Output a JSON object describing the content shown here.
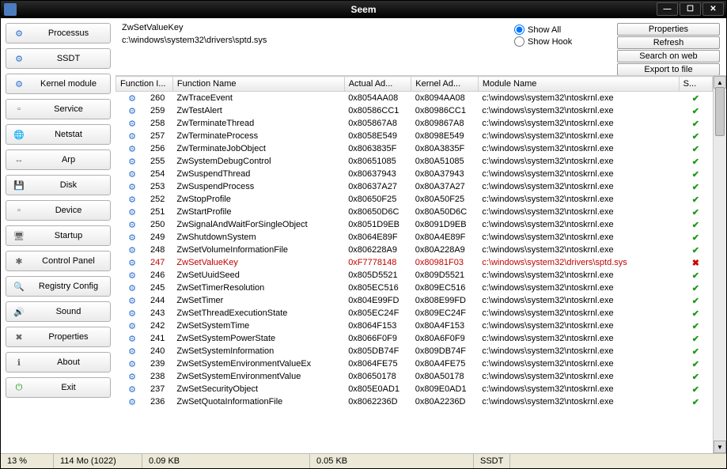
{
  "title": "Seem",
  "info": {
    "function_name": "ZwSetValueKey",
    "path": "c:\\windows\\system32\\drivers\\sptd.sys"
  },
  "radios": {
    "show_all": "Show All",
    "show_hook": "Show Hook",
    "selected": "show_all"
  },
  "buttons": {
    "properties": "Properties",
    "refresh": "Refresh",
    "search_web": "Search on web",
    "export": "Export to file"
  },
  "sidebar": [
    {
      "icon": "gear",
      "label": "Processus"
    },
    {
      "icon": "gear",
      "label": "SSDT"
    },
    {
      "icon": "gear",
      "label": "Kernel module"
    },
    {
      "icon": "page",
      "label": "Service"
    },
    {
      "icon": "globe",
      "label": "Netstat"
    },
    {
      "icon": "net",
      "label": "Arp"
    },
    {
      "icon": "disk",
      "label": "Disk"
    },
    {
      "icon": "page",
      "label": "Device"
    },
    {
      "icon": "monitor",
      "label": "Startup"
    },
    {
      "icon": "star",
      "label": "Control Panel"
    },
    {
      "icon": "search",
      "label": "Registry Config"
    },
    {
      "icon": "sound",
      "label": "Sound"
    },
    {
      "icon": "tools",
      "label": "Properties"
    },
    {
      "icon": "info",
      "label": "About"
    },
    {
      "icon": "power",
      "label": "Exit"
    }
  ],
  "columns": {
    "idx": "Function I...",
    "name": "Function Name",
    "actual": "Actual Ad...",
    "kernel": "Kernel Ad...",
    "module": "Module Name",
    "status": "S..."
  },
  "rows": [
    {
      "idx": "260",
      "name": "ZwTraceEvent",
      "actual": "0x8054AA08",
      "kernel": "0x8094AA08",
      "module": "c:\\windows\\system32\\ntoskrnl.exe",
      "ok": true
    },
    {
      "idx": "259",
      "name": "ZwTestAlert",
      "actual": "0x80586CC1",
      "kernel": "0x80986CC1",
      "module": "c:\\windows\\system32\\ntoskrnl.exe",
      "ok": true
    },
    {
      "idx": "258",
      "name": "ZwTerminateThread",
      "actual": "0x805867A8",
      "kernel": "0x809867A8",
      "module": "c:\\windows\\system32\\ntoskrnl.exe",
      "ok": true
    },
    {
      "idx": "257",
      "name": "ZwTerminateProcess",
      "actual": "0x8058E549",
      "kernel": "0x8098E549",
      "module": "c:\\windows\\system32\\ntoskrnl.exe",
      "ok": true
    },
    {
      "idx": "256",
      "name": "ZwTerminateJobObject",
      "actual": "0x8063835F",
      "kernel": "0x80A3835F",
      "module": "c:\\windows\\system32\\ntoskrnl.exe",
      "ok": true
    },
    {
      "idx": "255",
      "name": "ZwSystemDebugControl",
      "actual": "0x80651085",
      "kernel": "0x80A51085",
      "module": "c:\\windows\\system32\\ntoskrnl.exe",
      "ok": true
    },
    {
      "idx": "254",
      "name": "ZwSuspendThread",
      "actual": "0x80637943",
      "kernel": "0x80A37943",
      "module": "c:\\windows\\system32\\ntoskrnl.exe",
      "ok": true
    },
    {
      "idx": "253",
      "name": "ZwSuspendProcess",
      "actual": "0x80637A27",
      "kernel": "0x80A37A27",
      "module": "c:\\windows\\system32\\ntoskrnl.exe",
      "ok": true
    },
    {
      "idx": "252",
      "name": "ZwStopProfile",
      "actual": "0x80650F25",
      "kernel": "0x80A50F25",
      "module": "c:\\windows\\system32\\ntoskrnl.exe",
      "ok": true
    },
    {
      "idx": "251",
      "name": "ZwStartProfile",
      "actual": "0x80650D6C",
      "kernel": "0x80A50D6C",
      "module": "c:\\windows\\system32\\ntoskrnl.exe",
      "ok": true
    },
    {
      "idx": "250",
      "name": "ZwSignalAndWaitForSingleObject",
      "actual": "0x8051D9EB",
      "kernel": "0x8091D9EB",
      "module": "c:\\windows\\system32\\ntoskrnl.exe",
      "ok": true
    },
    {
      "idx": "249",
      "name": "ZwShutdownSystem",
      "actual": "0x8064E89F",
      "kernel": "0x80A4E89F",
      "module": "c:\\windows\\system32\\ntoskrnl.exe",
      "ok": true
    },
    {
      "idx": "248",
      "name": "ZwSetVolumeInformationFile",
      "actual": "0x806228A9",
      "kernel": "0x80A228A9",
      "module": "c:\\windows\\system32\\ntoskrnl.exe",
      "ok": true
    },
    {
      "idx": "247",
      "name": "ZwSetValueKey",
      "actual": "0xF7778148",
      "kernel": "0x80981F03",
      "module": "c:\\windows\\system32\\drivers\\sptd.sys",
      "ok": false,
      "hooked": true
    },
    {
      "idx": "246",
      "name": "ZwSetUuidSeed",
      "actual": "0x805D5521",
      "kernel": "0x809D5521",
      "module": "c:\\windows\\system32\\ntoskrnl.exe",
      "ok": true
    },
    {
      "idx": "245",
      "name": "ZwSetTimerResolution",
      "actual": "0x805EC516",
      "kernel": "0x809EC516",
      "module": "c:\\windows\\system32\\ntoskrnl.exe",
      "ok": true
    },
    {
      "idx": "244",
      "name": "ZwSetTimer",
      "actual": "0x804E99FD",
      "kernel": "0x808E99FD",
      "module": "c:\\windows\\system32\\ntoskrnl.exe",
      "ok": true
    },
    {
      "idx": "243",
      "name": "ZwSetThreadExecutionState",
      "actual": "0x805EC24F",
      "kernel": "0x809EC24F",
      "module": "c:\\windows\\system32\\ntoskrnl.exe",
      "ok": true
    },
    {
      "idx": "242",
      "name": "ZwSetSystemTime",
      "actual": "0x8064F153",
      "kernel": "0x80A4F153",
      "module": "c:\\windows\\system32\\ntoskrnl.exe",
      "ok": true
    },
    {
      "idx": "241",
      "name": "ZwSetSystemPowerState",
      "actual": "0x8066F0F9",
      "kernel": "0x80A6F0F9",
      "module": "c:\\windows\\system32\\ntoskrnl.exe",
      "ok": true
    },
    {
      "idx": "240",
      "name": "ZwSetSystemInformation",
      "actual": "0x805DB74F",
      "kernel": "0x809DB74F",
      "module": "c:\\windows\\system32\\ntoskrnl.exe",
      "ok": true
    },
    {
      "idx": "239",
      "name": "ZwSetSystemEnvironmentValueEx",
      "actual": "0x8064FE75",
      "kernel": "0x80A4FE75",
      "module": "c:\\windows\\system32\\ntoskrnl.exe",
      "ok": true
    },
    {
      "idx": "238",
      "name": "ZwSetSystemEnvironmentValue",
      "actual": "0x80650178",
      "kernel": "0x80A50178",
      "module": "c:\\windows\\system32\\ntoskrnl.exe",
      "ok": true
    },
    {
      "idx": "237",
      "name": "ZwSetSecurityObject",
      "actual": "0x805E0AD1",
      "kernel": "0x809E0AD1",
      "module": "c:\\windows\\system32\\ntoskrnl.exe",
      "ok": true
    },
    {
      "idx": "236",
      "name": "ZwSetQuotaInformationFile",
      "actual": "0x8062236D",
      "kernel": "0x80A2236D",
      "module": "c:\\windows\\system32\\ntoskrnl.exe",
      "ok": true
    }
  ],
  "statusbar": {
    "pct": "13 %",
    "mem": "114 Mo (1022)",
    "kb1": "0.09 KB",
    "kb2": "0.05 KB",
    "mode": "SSDT"
  }
}
